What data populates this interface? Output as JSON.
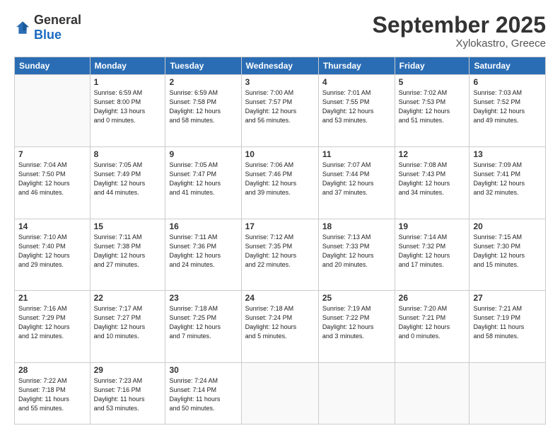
{
  "logo": {
    "text_general": "General",
    "text_blue": "Blue"
  },
  "header": {
    "month": "September 2025",
    "location": "Xylokastro, Greece"
  },
  "days": [
    "Sunday",
    "Monday",
    "Tuesday",
    "Wednesday",
    "Thursday",
    "Friday",
    "Saturday"
  ],
  "weeks": [
    [
      {
        "day": "",
        "info": ""
      },
      {
        "day": "1",
        "info": "Sunrise: 6:59 AM\nSunset: 8:00 PM\nDaylight: 13 hours\nand 0 minutes."
      },
      {
        "day": "2",
        "info": "Sunrise: 6:59 AM\nSunset: 7:58 PM\nDaylight: 12 hours\nand 58 minutes."
      },
      {
        "day": "3",
        "info": "Sunrise: 7:00 AM\nSunset: 7:57 PM\nDaylight: 12 hours\nand 56 minutes."
      },
      {
        "day": "4",
        "info": "Sunrise: 7:01 AM\nSunset: 7:55 PM\nDaylight: 12 hours\nand 53 minutes."
      },
      {
        "day": "5",
        "info": "Sunrise: 7:02 AM\nSunset: 7:53 PM\nDaylight: 12 hours\nand 51 minutes."
      },
      {
        "day": "6",
        "info": "Sunrise: 7:03 AM\nSunset: 7:52 PM\nDaylight: 12 hours\nand 49 minutes."
      }
    ],
    [
      {
        "day": "7",
        "info": "Sunrise: 7:04 AM\nSunset: 7:50 PM\nDaylight: 12 hours\nand 46 minutes."
      },
      {
        "day": "8",
        "info": "Sunrise: 7:05 AM\nSunset: 7:49 PM\nDaylight: 12 hours\nand 44 minutes."
      },
      {
        "day": "9",
        "info": "Sunrise: 7:05 AM\nSunset: 7:47 PM\nDaylight: 12 hours\nand 41 minutes."
      },
      {
        "day": "10",
        "info": "Sunrise: 7:06 AM\nSunset: 7:46 PM\nDaylight: 12 hours\nand 39 minutes."
      },
      {
        "day": "11",
        "info": "Sunrise: 7:07 AM\nSunset: 7:44 PM\nDaylight: 12 hours\nand 37 minutes."
      },
      {
        "day": "12",
        "info": "Sunrise: 7:08 AM\nSunset: 7:43 PM\nDaylight: 12 hours\nand 34 minutes."
      },
      {
        "day": "13",
        "info": "Sunrise: 7:09 AM\nSunset: 7:41 PM\nDaylight: 12 hours\nand 32 minutes."
      }
    ],
    [
      {
        "day": "14",
        "info": "Sunrise: 7:10 AM\nSunset: 7:40 PM\nDaylight: 12 hours\nand 29 minutes."
      },
      {
        "day": "15",
        "info": "Sunrise: 7:11 AM\nSunset: 7:38 PM\nDaylight: 12 hours\nand 27 minutes."
      },
      {
        "day": "16",
        "info": "Sunrise: 7:11 AM\nSunset: 7:36 PM\nDaylight: 12 hours\nand 24 minutes."
      },
      {
        "day": "17",
        "info": "Sunrise: 7:12 AM\nSunset: 7:35 PM\nDaylight: 12 hours\nand 22 minutes."
      },
      {
        "day": "18",
        "info": "Sunrise: 7:13 AM\nSunset: 7:33 PM\nDaylight: 12 hours\nand 20 minutes."
      },
      {
        "day": "19",
        "info": "Sunrise: 7:14 AM\nSunset: 7:32 PM\nDaylight: 12 hours\nand 17 minutes."
      },
      {
        "day": "20",
        "info": "Sunrise: 7:15 AM\nSunset: 7:30 PM\nDaylight: 12 hours\nand 15 minutes."
      }
    ],
    [
      {
        "day": "21",
        "info": "Sunrise: 7:16 AM\nSunset: 7:29 PM\nDaylight: 12 hours\nand 12 minutes."
      },
      {
        "day": "22",
        "info": "Sunrise: 7:17 AM\nSunset: 7:27 PM\nDaylight: 12 hours\nand 10 minutes."
      },
      {
        "day": "23",
        "info": "Sunrise: 7:18 AM\nSunset: 7:25 PM\nDaylight: 12 hours\nand 7 minutes."
      },
      {
        "day": "24",
        "info": "Sunrise: 7:18 AM\nSunset: 7:24 PM\nDaylight: 12 hours\nand 5 minutes."
      },
      {
        "day": "25",
        "info": "Sunrise: 7:19 AM\nSunset: 7:22 PM\nDaylight: 12 hours\nand 3 minutes."
      },
      {
        "day": "26",
        "info": "Sunrise: 7:20 AM\nSunset: 7:21 PM\nDaylight: 12 hours\nand 0 minutes."
      },
      {
        "day": "27",
        "info": "Sunrise: 7:21 AM\nSunset: 7:19 PM\nDaylight: 11 hours\nand 58 minutes."
      }
    ],
    [
      {
        "day": "28",
        "info": "Sunrise: 7:22 AM\nSunset: 7:18 PM\nDaylight: 11 hours\nand 55 minutes."
      },
      {
        "day": "29",
        "info": "Sunrise: 7:23 AM\nSunset: 7:16 PM\nDaylight: 11 hours\nand 53 minutes."
      },
      {
        "day": "30",
        "info": "Sunrise: 7:24 AM\nSunset: 7:14 PM\nDaylight: 11 hours\nand 50 minutes."
      },
      {
        "day": "",
        "info": ""
      },
      {
        "day": "",
        "info": ""
      },
      {
        "day": "",
        "info": ""
      },
      {
        "day": "",
        "info": ""
      }
    ]
  ]
}
